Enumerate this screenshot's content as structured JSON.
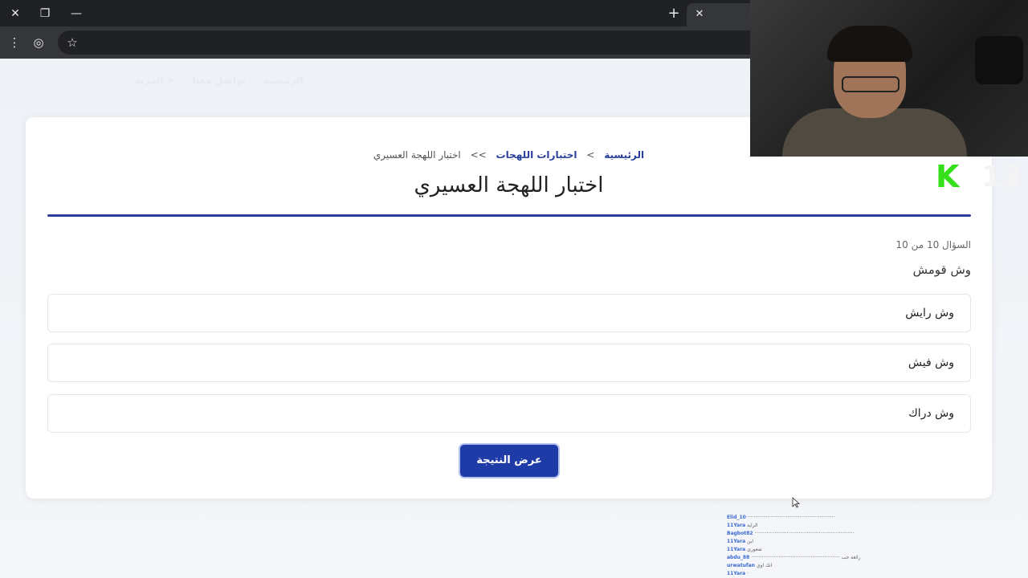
{
  "browser": {
    "new_tab_glyph": "+",
    "tab_close_glyph": "✕",
    "close_glyph": "✕",
    "restore_glyph": "❐",
    "minimize_glyph": "—",
    "menu_glyph": "⋮",
    "profile_glyph": "◎",
    "bookmark_glyph": "☆"
  },
  "site_nav": {
    "items": [
      "الرئيسية",
      "تواصل معنا",
      "< المزيد"
    ]
  },
  "breadcrumb": {
    "home": "الرئيسية",
    "sep1": ">",
    "section": "اختبارات اللهجات",
    "sep2": ">>",
    "current": "اختبار اللهجة العسيري"
  },
  "quiz": {
    "title": "اختبار اللهجة العسيري",
    "progress": "السؤال 10 من 10",
    "question": "وش قومش",
    "options": [
      "وش رايش",
      "وش فيش",
      "وش دراك"
    ],
    "submit_label": "عرض النتيجة"
  },
  "overlay": {
    "kick_logo": "K",
    "viewer_count": "13",
    "chat": [
      {
        "user": "Elid_10",
        "msg": "·························································"
      },
      {
        "user": "11Yara",
        "msg": "الراية"
      },
      {
        "user": "Bagbot82",
        "msg": "·································································"
      },
      {
        "user": "11Yara",
        "msg": "اين"
      },
      {
        "user": "11Yara",
        "msg": "شعوري"
      },
      {
        "user": "abdu_88",
        "msg": "·························································· رائعة حب"
      },
      {
        "user": "urwatufan",
        "msg": "انك اوي"
      },
      {
        "user": "11Yara",
        "msg": "·"
      }
    ]
  },
  "colors": {
    "accent": "#1f3ba8",
    "link": "#2a3f9c",
    "kick_green": "#35e01b"
  }
}
